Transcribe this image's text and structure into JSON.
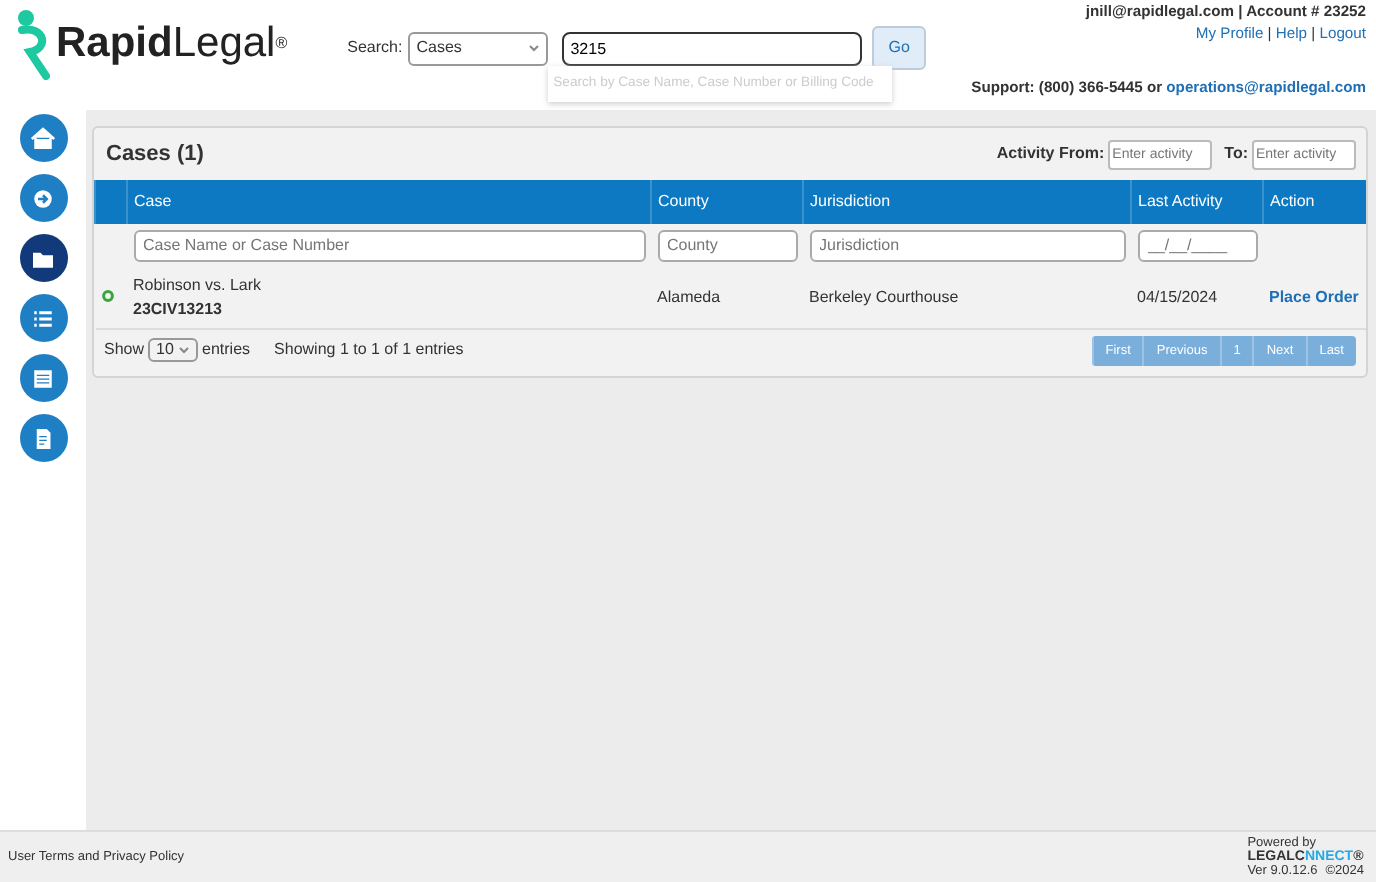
{
  "logo": "**Rapid**Legal$^{®}$",
  "search": {
    "label": "Search:",
    "scope": "Cases",
    "value": "3215",
    "hint": "Search by Case Name, Case Number or Billing Code",
    "button": "Go"
  },
  "account": {
    "email": "jnill@rapidlegal.com",
    "separator": "|",
    "account": "Account # 23252",
    "links": [
      "My Profile",
      "Help",
      "Logout"
    ]
  },
  "support": {
    "label": "Support: (800) 366-5445 or",
    "email": "operations@rapidlegal.com"
  },
  "sidebar": [
    {
      "kind": "home",
      "selected": false
    },
    {
      "kind": "arrow",
      "selected": false
    },
    {
      "kind": "folder",
      "selected": true
    },
    {
      "kind": "list",
      "selected": false
    },
    {
      "kind": "table",
      "selected": false
    },
    {
      "kind": "document",
      "selected": false
    }
  ],
  "panel": {
    "title": "Cases (1)",
    "activity_from": {
      "label": "Activity From:",
      "placeholder": "Enter activity"
    },
    "activity_to": {
      "label": "To:",
      "placeholder": "Enter activity"
    }
  },
  "table": {
    "columns": [
      "Case",
      "County",
      "Jurisdiction",
      "Last Activity",
      "Action"
    ],
    "filters": [
      {
        "placeholder": "Case Name or Case Number"
      },
      {
        "placeholder": "County"
      },
      {
        "placeholder": "Jurisdiction"
      },
      {
        "placeholder": "__/__/____"
      }
    ],
    "rows": [
      {
        "color": "#3aa53a",
        "case_name": "Robinson vs. Lark",
        "case_number": "23CIV13213",
        "county": "Alameda",
        "jurisdiction": "Berkeley Courthouse",
        "last_activity": "04/15/2024",
        "action": "Place Order"
      }
    ]
  },
  "length": {
    "show": "Show",
    "value": "10",
    "entries": "entries"
  },
  "info": "Showing 1 to 1 of 1 entries",
  "pagination": [
    "First",
    "Previous",
    "1",
    "Next",
    "Last"
  ],
  "footer": {
    "terms": "User Terms and Privacy Policy",
    "powered": "Powered by",
    "brand_a": "LEGALC",
    "brand_b": "NNECT",
    "reg": "®",
    "version": "Ver 9.0.12.6",
    "year": "©2024"
  }
}
